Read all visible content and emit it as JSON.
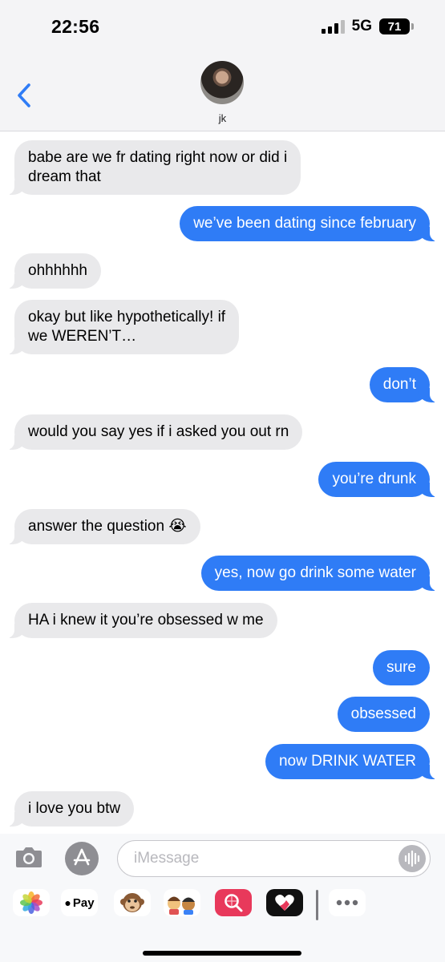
{
  "status_bar": {
    "time": "22:56",
    "network": "5G",
    "battery": "71"
  },
  "header": {
    "contact_name": "jk"
  },
  "messages": [
    {
      "direction": "in",
      "lines": [
        "babe are we fr dating right now or did i",
        "dream that"
      ]
    },
    {
      "direction": "out",
      "lines": [
        "we’ve been dating since february"
      ]
    },
    {
      "direction": "in",
      "lines": [
        "ohhhhhh"
      ]
    },
    {
      "direction": "in",
      "lines": [
        "okay but like hypothetically! if",
        "we WEREN’T…"
      ]
    },
    {
      "direction": "out",
      "lines": [
        "don’t"
      ]
    },
    {
      "direction": "in",
      "lines": [
        "would you say yes if i asked you out rn"
      ]
    },
    {
      "direction": "out",
      "lines": [
        "you’re drunk"
      ]
    },
    {
      "direction": "in",
      "lines": [
        "answer the question 😭"
      ]
    },
    {
      "direction": "out",
      "lines": [
        "yes, now go drink some water"
      ]
    },
    {
      "direction": "in",
      "lines": [
        "HA i knew it you’re obsessed w me"
      ]
    },
    {
      "direction": "out",
      "lines": [
        "sure"
      ]
    },
    {
      "direction": "out",
      "lines": [
        "obsessed"
      ]
    },
    {
      "direction": "out",
      "lines": [
        "now DRINK WATER"
      ]
    },
    {
      "direction": "in",
      "lines": [
        "i love you btw"
      ]
    }
  ],
  "input": {
    "placeholder": "iMessage",
    "value": ""
  },
  "apps": {
    "apple_pay_label": "Pay",
    "icons": [
      "photos-icon",
      "apple-pay-icon",
      "monkey-animoji-icon",
      "memoji-icon",
      "image-search-icon",
      "digital-touch-icon",
      "more-icon"
    ]
  },
  "colors": {
    "outgoing_bubble": "#2f7cf6",
    "incoming_bubble": "#e9e9eb",
    "accent": "#2f7cf6"
  }
}
